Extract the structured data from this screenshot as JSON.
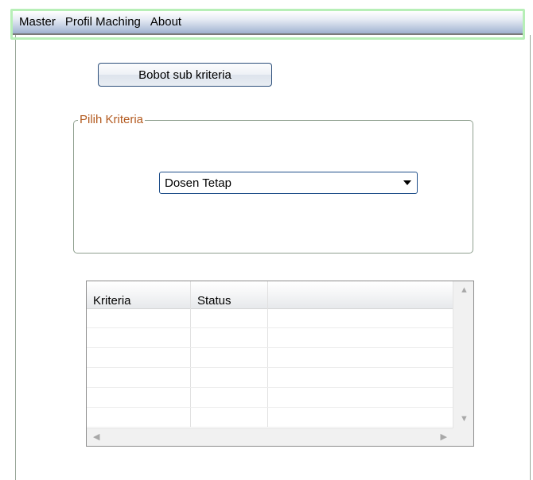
{
  "menu": {
    "items": [
      {
        "label": "Master"
      },
      {
        "label": "Profil Maching"
      },
      {
        "label": "About"
      }
    ]
  },
  "main": {
    "bobot_button_label": "Bobot sub kriteria",
    "groupbox_title": "Pilih Kriteria",
    "kriteria_select": {
      "value": "Dosen Tetap"
    },
    "table": {
      "columns": [
        "Kriteria",
        "Status",
        ""
      ],
      "rows": [
        [
          "",
          "",
          ""
        ],
        [
          "",
          "",
          ""
        ],
        [
          "",
          "",
          ""
        ],
        [
          "",
          "",
          ""
        ],
        [
          "",
          "",
          ""
        ],
        [
          "",
          "",
          ""
        ]
      ]
    }
  },
  "colors": {
    "menubar_gradient_end": "#9fb1cf",
    "groupbox_title": "#b35a1f",
    "button_border": "#2c4e7a",
    "highlight_outline": "#b7efb7"
  }
}
